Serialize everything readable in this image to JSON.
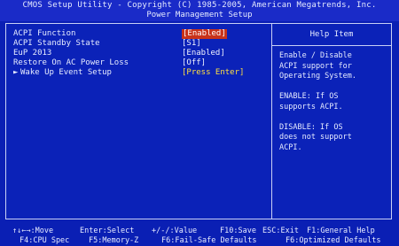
{
  "header": {
    "title": "CMOS Setup Utility - Copyright (C) 1985-2005, American Megatrends, Inc.",
    "subtitle": "Power Management Setup"
  },
  "settings": [
    {
      "label": "ACPI Function",
      "value": "[Enabled]",
      "selected": true
    },
    {
      "label": "ACPI Standby State",
      "value": "[S1]",
      "selected": false
    },
    {
      "label": "EuP 2013",
      "value": "[Enabled]",
      "selected": false
    },
    {
      "label": "Restore On AC Power Loss",
      "value": "[Off]",
      "selected": false
    },
    {
      "label": "Wake Up Event Setup",
      "value": "[Press Enter]",
      "selected": false,
      "submenu": true
    }
  ],
  "help": {
    "title": "Help Item",
    "paragraphs": [
      "Enable / Disable\nACPI support for\nOperating System.",
      "ENABLE: If OS\nsupports ACPI.",
      "DISABLE: If OS\ndoes not support\nACPI."
    ]
  },
  "footer": {
    "line1": [
      "↑↓←→:Move",
      "Enter:Select",
      "+/-/:Value",
      "F10:Save",
      "ESC:Exit",
      "F1:General Help"
    ],
    "line2": [
      "F4:CPU Spec",
      "F5:Memory-Z",
      "F6:Fail-Safe Defaults",
      "F6:Optimized Defaults"
    ]
  },
  "colors": {
    "background": "#0a1fb4",
    "selected_value": "#c8321a",
    "submenu_value": "#ffe040",
    "text": "#e6ebff"
  },
  "icons": {
    "submenu": "triangle-right-icon"
  }
}
